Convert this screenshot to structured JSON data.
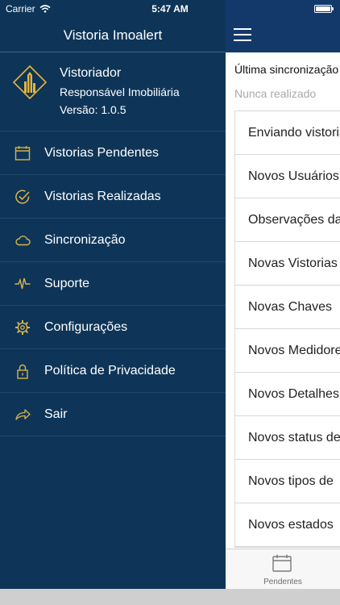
{
  "status_bar": {
    "carrier": "Carrier",
    "time": "5:47 AM"
  },
  "drawer": {
    "title": "Vistoria Imoalert",
    "profile": {
      "name": "Vistoriador",
      "role": "Responsável Imobiliária",
      "version": "Versão: 1.0.5"
    },
    "menu": [
      {
        "label": "Vistorias Pendentes",
        "icon": "calendar-icon"
      },
      {
        "label": "Vistorias Realizadas",
        "icon": "check-circle-icon"
      },
      {
        "label": "Sincronização",
        "icon": "cloud-icon"
      },
      {
        "label": "Suporte",
        "icon": "pulse-icon"
      },
      {
        "label": "Configurações",
        "icon": "gear-icon"
      },
      {
        "label": "Política de Privacidade",
        "icon": "lock-icon"
      },
      {
        "label": "Sair",
        "icon": "share-arrow-icon"
      }
    ]
  },
  "main": {
    "sync_label": "Última sincronização",
    "sync_value": "Nunca realizado",
    "sync_items": [
      "Enviando vistorias",
      "Novos Usuários",
      "Observações da",
      "Novas Vistorias",
      "Novas Chaves",
      "Novos Medidores",
      "Novos Detalhes",
      "Novos status de",
      "Novos tipos de",
      "Novos estados"
    ],
    "tab_label": "Pendentes"
  },
  "colors": {
    "drawer_bg": "#0e3558",
    "navbar_bg": "#12396a",
    "icon_gold": "#d9b24a",
    "logo_gold": "#e5b53b"
  }
}
